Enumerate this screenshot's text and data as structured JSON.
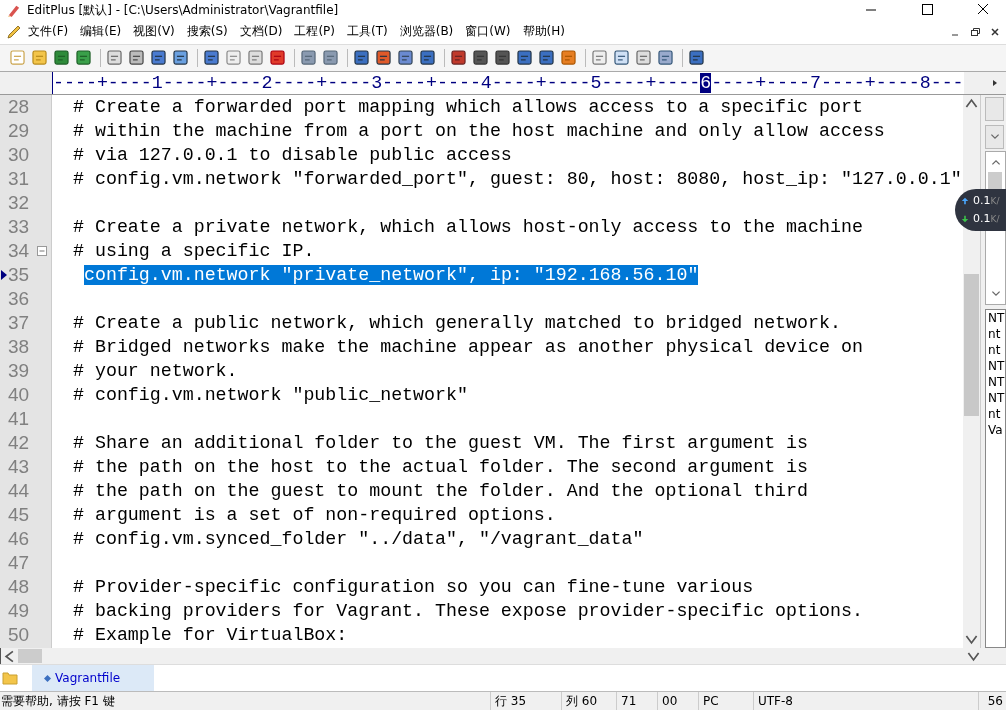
{
  "window": {
    "title": "EditPlus [默认] - [C:\\Users\\Administrator\\Vagrantfile]"
  },
  "menu": [
    "文件(F)",
    "编辑(E)",
    "视图(V)",
    "搜索(S)",
    "文档(D)",
    "工程(P)",
    "工具(T)",
    "浏览器(B)",
    "窗口(W)",
    "帮助(H)"
  ],
  "ruler": {
    "before": "----+----1----+----2----+----3----+----4----+----5----+----",
    "cursor": "6",
    "after": "----+----7----+----8---"
  },
  "lines": [
    {
      "number": "28",
      "text": "# Create a forwarded port mapping which allows access to a specific port"
    },
    {
      "number": "29",
      "text": "# within the machine from a port on the host machine and only allow access"
    },
    {
      "number": "30",
      "text": "# via 127.0.0.1 to disable public access"
    },
    {
      "number": "31",
      "text": "# config.vm.network \"forwarded_port\", guest: 80, host: 8080, host_ip: \"127.0.0.1\""
    },
    {
      "number": "32"
    },
    {
      "number": "33",
      "text": "# Create a private network, which allows host-only access to the machine"
    },
    {
      "number": "34",
      "text": "# using a specific IP.",
      "fold": true
    },
    {
      "number": "35",
      "selection": "config.vm.network \"private_network\", ip: \"192.168.56.10\"",
      "current": true
    },
    {
      "number": "36"
    },
    {
      "number": "37",
      "text": "# Create a public network, which generally matched to bridged network."
    },
    {
      "number": "38",
      "text": "# Bridged networks make the machine appear as another physical device on"
    },
    {
      "number": "39",
      "text": "# your network."
    },
    {
      "number": "40",
      "text": "# config.vm.network \"public_network\""
    },
    {
      "number": "41"
    },
    {
      "number": "42",
      "text": "# Share an additional folder to the guest VM. The first argument is"
    },
    {
      "number": "43",
      "text": "# the path on the host to the actual folder. The second argument is"
    },
    {
      "number": "44",
      "text": "# the path on the guest to mount the folder. And the optional third"
    },
    {
      "number": "45",
      "text": "# argument is a set of non-required options."
    },
    {
      "number": "46",
      "text": "# config.vm.synced_folder \"../data\", \"/vagrant_data\""
    },
    {
      "number": "47"
    },
    {
      "number": "48",
      "text": "# Provider-specific configuration so you can fine-tune various"
    },
    {
      "number": "49",
      "text": "# backing providers for Vagrant. These expose provider-specific options."
    },
    {
      "number": "50",
      "text": "# Example for VirtualBox:"
    }
  ],
  "side_list": [
    "NT",
    "nt",
    "nt",
    "NT",
    "NT",
    "NT",
    "nt",
    "Va"
  ],
  "speed": {
    "upload": "0.1",
    "upload_unit": "K/",
    "download": "0.1",
    "download_unit": "K/"
  },
  "tabs": [
    {
      "label": "Vagrantfile",
      "selected": true
    }
  ],
  "status_bar": {
    "help": "需要帮助, 请按 F1 键",
    "fields": [
      "行 35",
      "列 60",
      "71",
      "00",
      "PC",
      "UTF-8",
      "56"
    ]
  }
}
